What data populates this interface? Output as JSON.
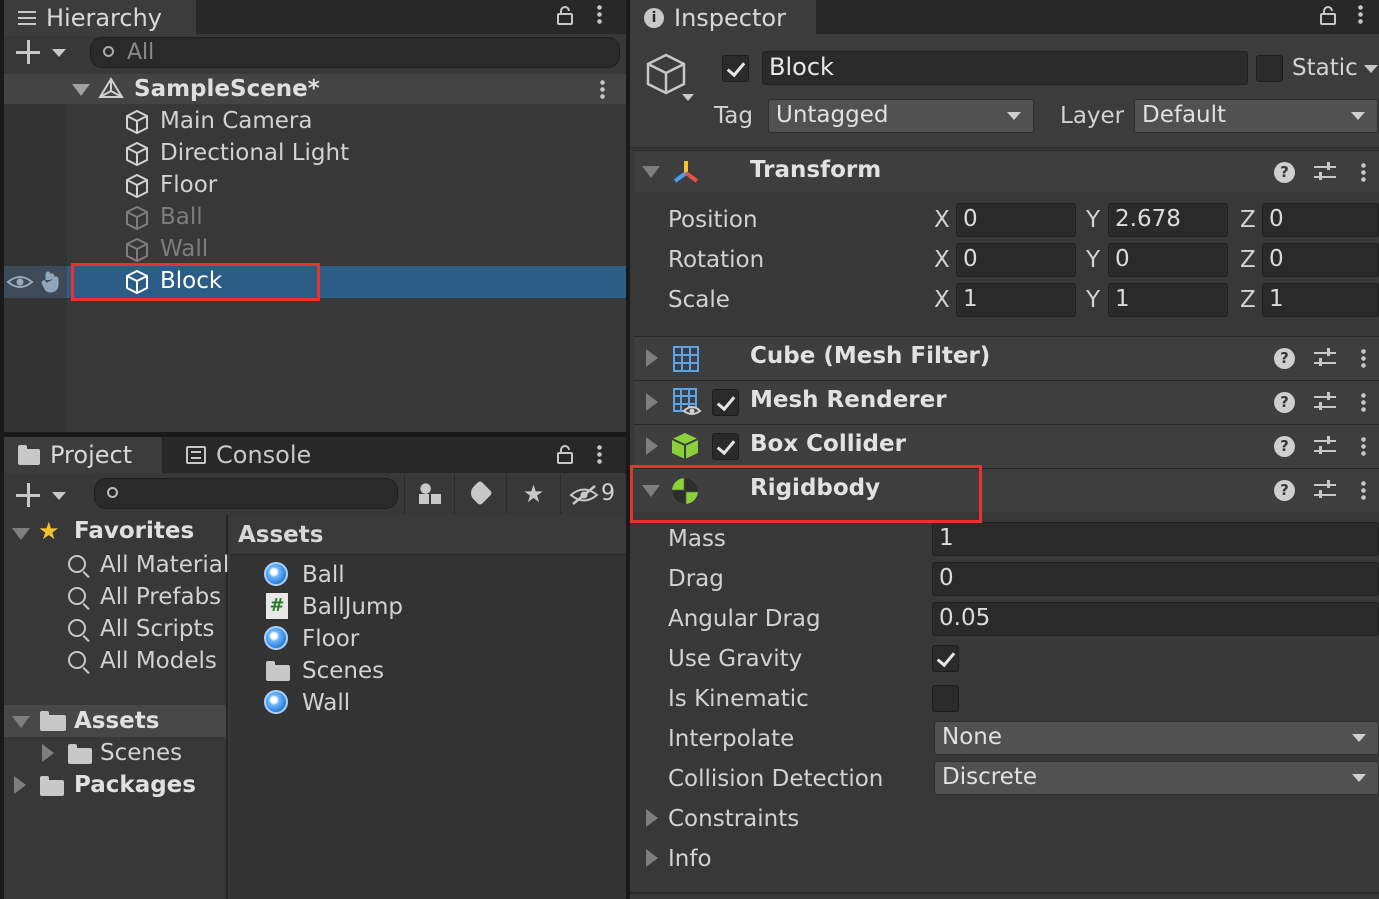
{
  "hierarchy": {
    "tab_label": "Hierarchy",
    "search_placeholder": "All",
    "scene_name": "SampleScene*",
    "items": [
      {
        "label": "Main Camera",
        "dimmed": false
      },
      {
        "label": "Directional Light",
        "dimmed": false
      },
      {
        "label": "Floor",
        "dimmed": false
      },
      {
        "label": "Ball",
        "dimmed": true
      },
      {
        "label": "Wall",
        "dimmed": true
      },
      {
        "label": "Block",
        "dimmed": false,
        "selected": true
      }
    ]
  },
  "project": {
    "tabs": [
      "Project",
      "Console"
    ],
    "hidden_count": "9",
    "favorites_label": "Favorites",
    "favorites": [
      "All Material",
      "All Prefabs",
      "All Scripts",
      "All Models"
    ],
    "tree": {
      "assets": "Assets",
      "scenes": "Scenes",
      "packages": "Packages"
    },
    "assets_header": "Assets",
    "assets": [
      "Ball",
      "BallJump",
      "Floor",
      "Scenes",
      "Wall"
    ]
  },
  "inspector": {
    "tab_label": "Inspector",
    "object_name": "Block",
    "static_label": "Static",
    "tag_label": "Tag",
    "tag_value": "Untagged",
    "layer_label": "Layer",
    "layer_value": "Default",
    "transform": {
      "title": "Transform",
      "rows": [
        {
          "label": "Position",
          "x": "0",
          "y": "2.678",
          "z": "0"
        },
        {
          "label": "Rotation",
          "x": "0",
          "y": "0",
          "z": "0"
        },
        {
          "label": "Scale",
          "x": "1",
          "y": "1",
          "z": "1"
        }
      ],
      "axis": {
        "x": "X",
        "y": "Y",
        "z": "Z"
      }
    },
    "components": [
      "Cube (Mesh Filter)",
      "Mesh Renderer",
      "Box Collider",
      "Rigidbody"
    ],
    "rigidbody": {
      "mass_label": "Mass",
      "mass": "1",
      "drag_label": "Drag",
      "drag": "0",
      "angular_drag_label": "Angular Drag",
      "angular_drag": "0.05",
      "use_gravity_label": "Use Gravity",
      "is_kinematic_label": "Is Kinematic",
      "interpolate_label": "Interpolate",
      "interpolate": "None",
      "collision_label": "Collision Detection",
      "collision": "Discrete",
      "constraints_label": "Constraints",
      "info_label": "Info"
    }
  },
  "colors": {
    "highlight": "#e8322e",
    "selection": "#2c5d87",
    "panel": "#383838"
  }
}
